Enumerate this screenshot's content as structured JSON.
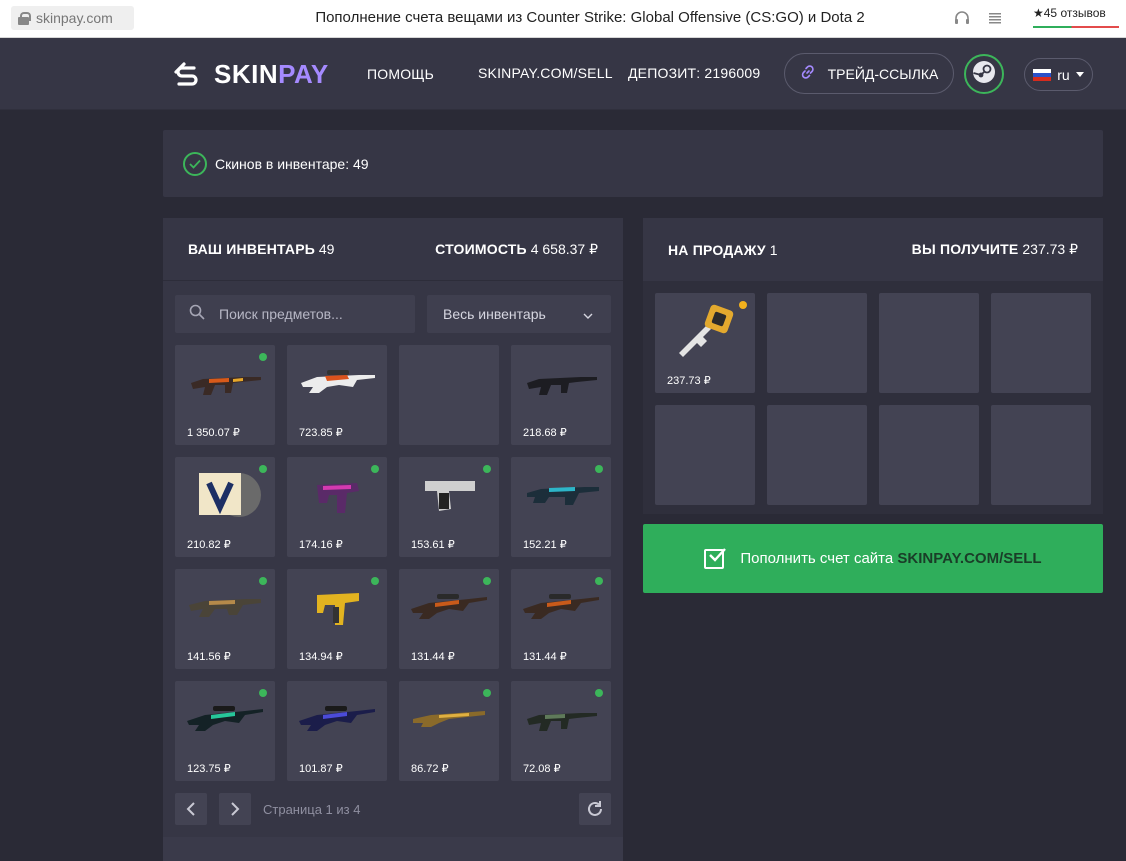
{
  "browser": {
    "url": "skinpay.com",
    "title": "Пополнение счета вещами из Counter Strike: Global Offensive (CS:GO) и Dota 2",
    "reviews": "★45 отзывов"
  },
  "header": {
    "logo_a": "SKIN",
    "logo_b": "PAY",
    "nav_help": "ПОМОЩЬ",
    "nav_sell": "SKINPAY.COM/SELL",
    "deposit": "ДЕПОЗИТ: 2196009",
    "trade_link": "ТРЕЙД-ССЫЛКА",
    "lang": "ru"
  },
  "notice": {
    "text": "Скинов в инвентаре: 49"
  },
  "inventory": {
    "title": "ВАШ ИНВЕНТАРЬ",
    "count": "49",
    "value_label": "СТОИМОСТЬ",
    "value": "4 658.37 ₽",
    "search_placeholder": "Поиск предметов...",
    "filter": "Весь инвентарь",
    "items": [
      {
        "price": "1 350.07 ₽",
        "available": true
      },
      {
        "price": "723.85 ₽",
        "available": false
      },
      {
        "price": "",
        "available": false
      },
      {
        "price": "218.68 ₽",
        "available": false
      },
      {
        "price": "210.82 ₽",
        "available": true
      },
      {
        "price": "174.16 ₽",
        "available": true
      },
      {
        "price": "153.61 ₽",
        "available": true
      },
      {
        "price": "152.21 ₽",
        "available": true
      },
      {
        "price": "141.56 ₽",
        "available": true
      },
      {
        "price": "134.94 ₽",
        "available": true
      },
      {
        "price": "131.44 ₽",
        "available": true
      },
      {
        "price": "131.44 ₽",
        "available": true
      },
      {
        "price": "123.75 ₽",
        "available": true
      },
      {
        "price": "101.87 ₽",
        "available": false
      },
      {
        "price": "86.72 ₽",
        "available": true
      },
      {
        "price": "72.08 ₽",
        "available": true
      }
    ],
    "page_text": "Страница 1 из 4"
  },
  "sale": {
    "title": "НА ПРОДАЖУ",
    "count": "1",
    "receive_label": "ВЫ ПОЛУЧИТЕ",
    "receive_value": "237.73 ₽",
    "item_price": "237.73 ₽"
  },
  "deposit_button": {
    "text": "Пополнить счет сайта",
    "strong": "SKINPAY.COM/SELL"
  },
  "colors": {
    "accent_green": "#2fae5b",
    "brand_purple": "#a58aff",
    "sale_dot": "#f2b11d"
  }
}
